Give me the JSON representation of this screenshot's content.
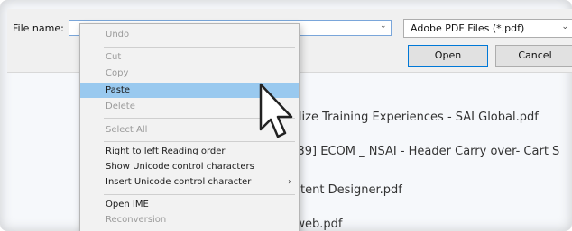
{
  "dialog": {
    "filename_label": "File name:",
    "filename_value": "",
    "filetype_value": "Adobe PDF Files (*.pdf)",
    "open_label": "Open",
    "cancel_label": "Cancel"
  },
  "file_list": [
    "sonalize Training Experiences - SAI Global.pdf",
    "3-2639] ECOM _ NSAI - Header Carry over- Cart S",
    "l Content Designer.pdf",
    "tter-web.pdf"
  ],
  "context_menu": {
    "items": [
      {
        "label": "Undo",
        "enabled": false
      },
      {
        "label": "Cut",
        "enabled": false
      },
      {
        "label": "Copy",
        "enabled": false
      },
      {
        "label": "Paste",
        "enabled": true,
        "highlighted": true
      },
      {
        "label": "Delete",
        "enabled": false
      },
      {
        "label": "Select All",
        "enabled": false
      },
      {
        "label": "Right to left Reading order",
        "enabled": true
      },
      {
        "label": "Show Unicode control characters",
        "enabled": true
      },
      {
        "label": "Insert Unicode control character",
        "enabled": true,
        "submenu": true
      },
      {
        "label": "Open IME",
        "enabled": true
      },
      {
        "label": "Reconversion",
        "enabled": false
      }
    ]
  },
  "colors": {
    "highlight": "#99c9ef",
    "accent_border": "#0078d7"
  },
  "icons": {
    "cursor": "arrow-cursor-icon",
    "dropdown": "chevron-down-icon",
    "submenu": "chevron-right-icon"
  }
}
